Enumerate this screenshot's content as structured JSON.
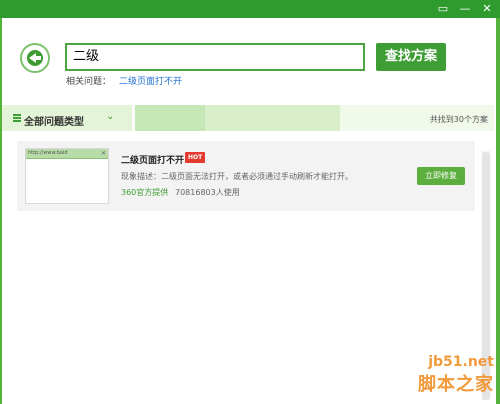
{
  "titlebar": {
    "menu_icon": "menu-icon",
    "minimize_glyph": "—",
    "close_glyph": "✕"
  },
  "search": {
    "value": "二级",
    "button_label": "查找方案"
  },
  "related": {
    "label": "相关问题：",
    "link": "二级页面打不开"
  },
  "category": {
    "label": "全部问题类型",
    "found_text": "共找到30个方案"
  },
  "results": [
    {
      "title": "二级页面打不开",
      "badge": "HOT",
      "description": "现象描述：二级页面无法打开，或者必须通过手动刷新才能打开。",
      "provider": "360官方提供",
      "users": "70816803人使用",
      "action_label": "立即修复",
      "thumbnail_url_text": "http://www.baid"
    }
  ],
  "watermark": {
    "site": "jb51.net",
    "name": "脚本之家"
  },
  "colors": {
    "brand_green": "#3e9d35",
    "titlebar_green": "#2f9b2f",
    "hot_red": "#e23a2f",
    "link_blue": "#1f6fd0",
    "watermark_orange": "#f29a3b"
  }
}
